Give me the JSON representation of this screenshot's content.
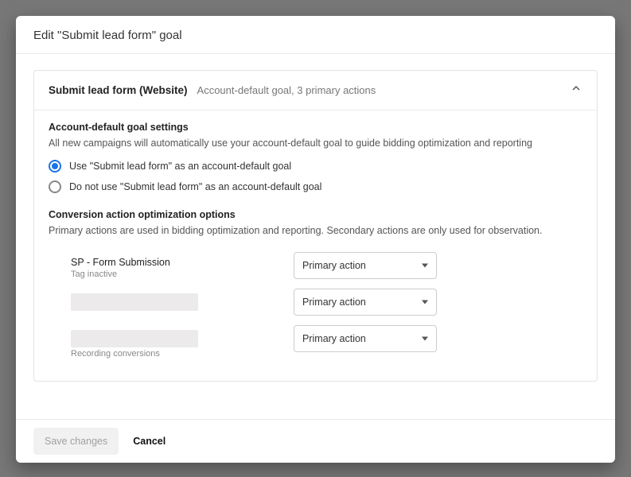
{
  "header": {
    "title": "Edit \"Submit lead form\" goal"
  },
  "card": {
    "title": "Submit lead form (Website)",
    "subtitle": "Account-default goal, 3 primary actions"
  },
  "default_settings": {
    "title": "Account-default goal settings",
    "description": "All new campaigns will automatically use your account-default goal to guide bidding optimization and reporting",
    "option_use": "Use \"Submit lead form\" as an account-default goal",
    "option_dont_use": "Do not use \"Submit lead form\" as an account-default goal",
    "selected": "use"
  },
  "optimization": {
    "title": "Conversion action optimization options",
    "description": "Primary actions are used in bidding optimization and reporting. Secondary actions are only used for observation."
  },
  "actions": [
    {
      "name": "SP - Form Submission",
      "status": "Tag inactive",
      "redacted": false,
      "selection": "Primary action"
    },
    {
      "name": "",
      "status": "",
      "redacted": true,
      "selection": "Primary action"
    },
    {
      "name": "",
      "status": "Recording conversions",
      "redacted": true,
      "selection": "Primary action"
    }
  ],
  "footer": {
    "save": "Save changes",
    "cancel": "Cancel"
  }
}
